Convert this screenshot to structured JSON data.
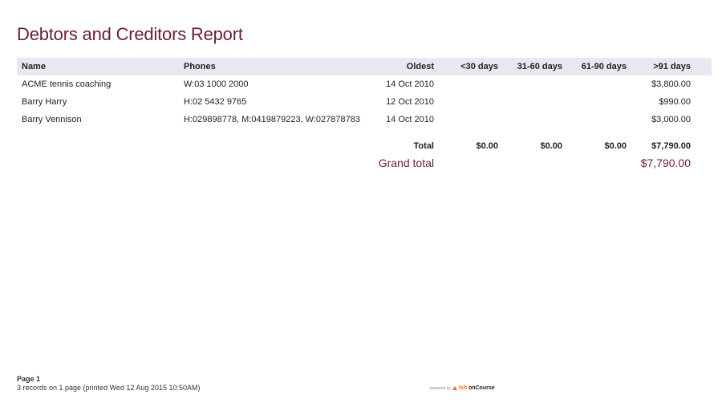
{
  "report": {
    "title": "Debtors and Creditors Report"
  },
  "table": {
    "headers": {
      "name": "Name",
      "phones": "Phones",
      "oldest": "Oldest",
      "lt30": "<30 days",
      "d31_60": "31-60 days",
      "d61_90": "61-90 days",
      "gt91": ">91 days"
    },
    "rows": [
      {
        "name": "ACME tennis coaching",
        "phones": "W:03 1000 2000",
        "oldest": "14 Oct 2010",
        "lt30": "",
        "d31_60": "",
        "d61_90": "",
        "gt91": "$3,800.00"
      },
      {
        "name": "Barry Harry",
        "phones": "H:02 5432 9765",
        "oldest": "12 Oct 2010",
        "lt30": "",
        "d31_60": "",
        "d61_90": "",
        "gt91": "$990.00"
      },
      {
        "name": "Barry Vennison",
        "phones": "H:029898778, M:0419879223, W:027878783",
        "oldest": "14 Oct 2010",
        "lt30": "",
        "d31_60": "",
        "d61_90": "",
        "gt91": "$3,000.00"
      }
    ],
    "total": {
      "label": "Total",
      "lt30": "$0.00",
      "d31_60": "$0.00",
      "d61_90": "$0.00",
      "gt91": "$7,790.00"
    },
    "grand_total": {
      "label": "Grand total",
      "value": "$7,790.00"
    }
  },
  "footer": {
    "page": "Page 1",
    "summary": "3 records on 1 page (printed Wed 12 Aug 2015 10:50AM)",
    "powered_by": "powered by",
    "brand_ish": "ish",
    "brand_oncourse": "onCourse"
  },
  "colors": {
    "title": "#6b1e3a",
    "header_bg": "#e8e8f2",
    "brand_accent": "#e8702a"
  }
}
